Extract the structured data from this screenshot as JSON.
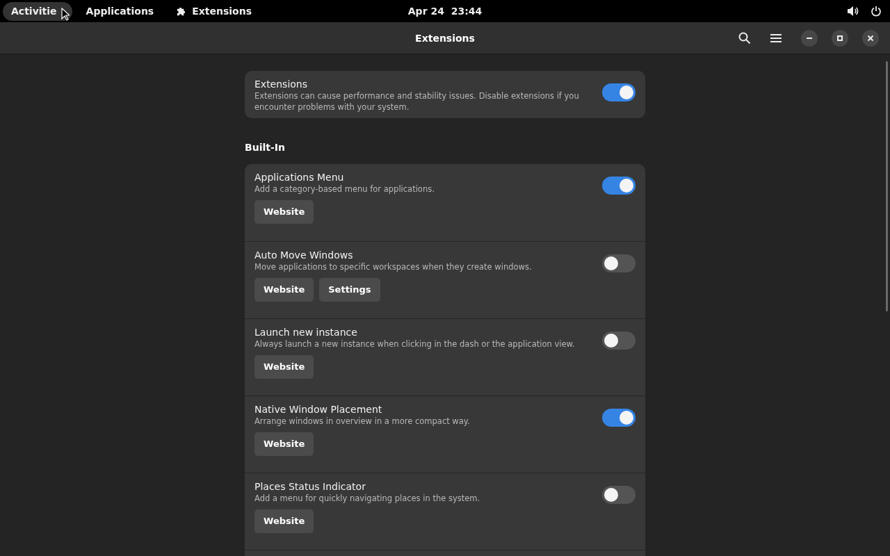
{
  "top_bar": {
    "activities": "Activitie",
    "applications": "Applications",
    "app_menu": "Extensions",
    "clock": "Apr 24  23:44"
  },
  "header": {
    "title": "Extensions"
  },
  "master": {
    "title": "Extensions",
    "description": "Extensions can cause performance and stability issues. Disable extensions if you encounter problems with your system.",
    "on": true
  },
  "sections": [
    {
      "heading": "Built-In",
      "extensions": [
        {
          "title": "Applications Menu",
          "description": "Add a category-based menu for applications.",
          "buttons": [
            "Website"
          ],
          "on": true
        },
        {
          "title": "Auto Move Windows",
          "description": "Move applications to specific workspaces when they create windows.",
          "buttons": [
            "Website",
            "Settings"
          ],
          "on": false
        },
        {
          "title": "Launch new instance",
          "description": "Always launch a new instance when clicking in the dash or the application view.",
          "buttons": [
            "Website"
          ],
          "on": false
        },
        {
          "title": "Native Window Placement",
          "description": "Arrange windows in overview in a more compact way.",
          "buttons": [
            "Website"
          ],
          "on": true
        },
        {
          "title": "Places Status Indicator",
          "description": "Add a menu for quickly navigating places in the system.",
          "buttons": [
            "Website"
          ],
          "on": false
        }
      ]
    }
  ]
}
